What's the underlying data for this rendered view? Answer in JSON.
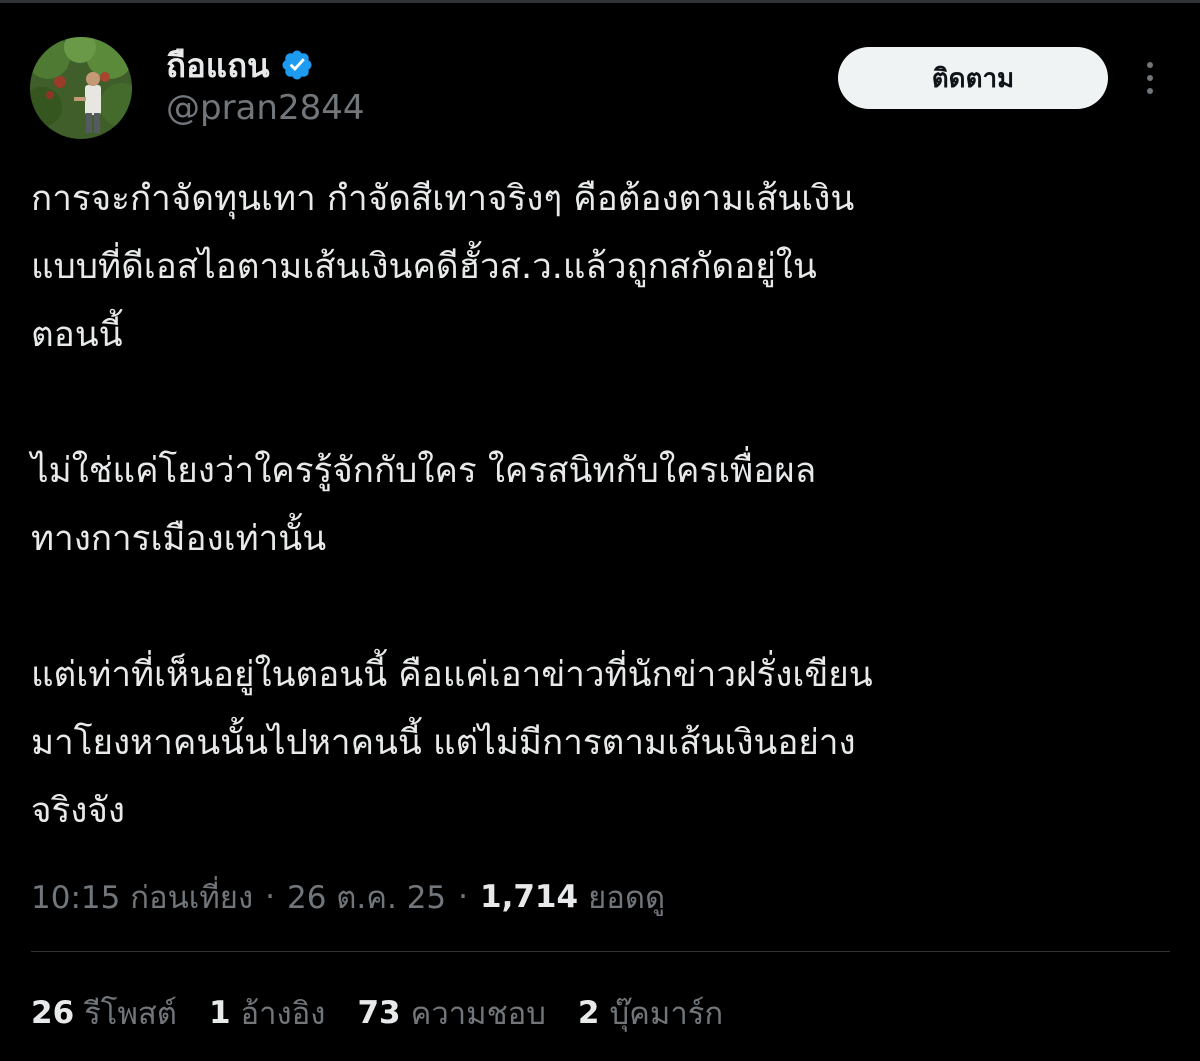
{
  "author": {
    "display_name": "ถือแถน",
    "handle": "@pran2844",
    "verified": true,
    "verified_color": "#1d9bf0"
  },
  "follow_button": {
    "label": "ติดตาม"
  },
  "more_icon": "more-dots-vertical-icon",
  "tweet": {
    "paragraphs": [
      {
        "lines": [
          "การจะกำจัดทุนเทา กำจัดสีเทาจริงๆ คือต้องตามเส้นเงิน",
          "แบบที่ดีเอสไอตามเส้นเงินคดีฮั้วส.ว.แล้วถูกสกัดอยู่ใน",
          "ตอนนี้"
        ]
      },
      {
        "lines": [
          "ไม่ใช่แค่โยงว่าใครรู้จักกับใคร ใครสนิทกับใครเพื่อผล",
          "ทางการเมืองเท่านั้น"
        ]
      },
      {
        "lines": [
          "แต่เท่าที่เห็นอยู่ในตอนนี้ คือแค่เอาข่าวที่นักข่าวฝรั่งเขียน",
          "มาโยงหาคนนั้นไปหาคนนี้ แต่ไม่มีการตามเส้นเงินอย่าง",
          "จริงจัง"
        ]
      }
    ]
  },
  "meta": {
    "time": "10:15 ก่อนเที่ยง",
    "separator": "·",
    "date": "26 ต.ค. 25",
    "views_count": "1,714",
    "views_label": "ยอดดู"
  },
  "stats": {
    "reposts": {
      "count": "26",
      "label": "รีโพสต์"
    },
    "quotes": {
      "count": "1",
      "label": "อ้างอิง"
    },
    "likes": {
      "count": "73",
      "label": "ความชอบ"
    },
    "bookmarks": {
      "count": "2",
      "label": "บุ๊คมาร์ก"
    }
  },
  "colors": {
    "background": "#000000",
    "text_primary": "#e7e9ea",
    "text_secondary": "#71767b",
    "divider": "#2f3336",
    "follow_button_bg": "#eff3f4",
    "follow_button_text": "#0f1419"
  }
}
